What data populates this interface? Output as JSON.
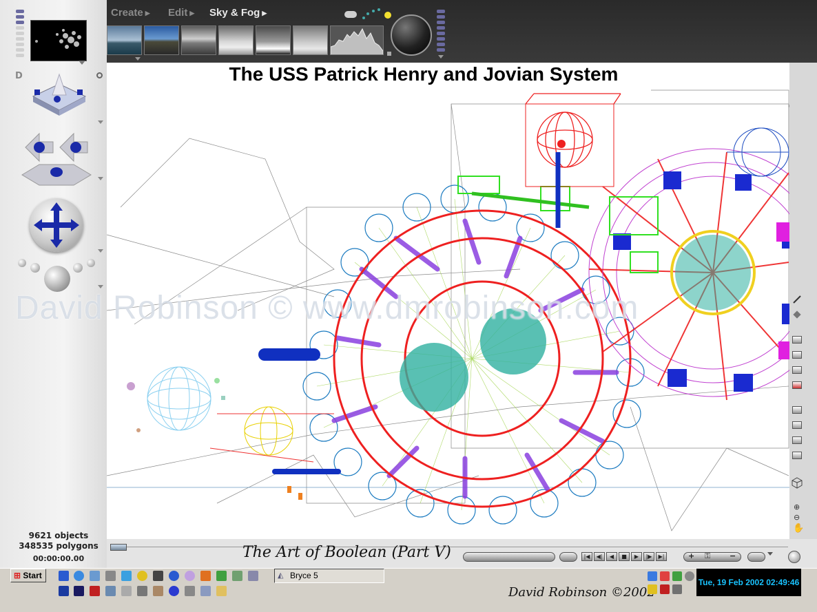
{
  "menus": [
    {
      "label": "Create",
      "active": false
    },
    {
      "label": "Edit",
      "active": false
    },
    {
      "label": "Sky & Fog",
      "active": true
    }
  ],
  "scene": {
    "title": "The USS Patrick Henry and Jovian System",
    "watermark": "David Robinson © www.dmrobinson.com"
  },
  "stats": {
    "objects": "9621 objects",
    "polygons": "348535 polygons",
    "time": "00:00:00.00"
  },
  "bottom": {
    "caption": "The Art of Boolean (Part V)",
    "signature": "David Robinson ©2002"
  },
  "taskbar": {
    "start_label": "Start",
    "window_button": "Bryce 5",
    "clock": "Tue, 19 Feb 2002 02:49:46"
  },
  "icons": {
    "quick_launch": [
      "app-a-icon",
      "internet-explorer-icon",
      "network-icon",
      "tool-icon",
      "photo-icon",
      "media-player-icon",
      "explorer-icon",
      "info-icon",
      "cd-icon",
      "flower-icon",
      "paint-icon",
      "image-icon",
      "plane-icon",
      "word-icon",
      "dots-icon",
      "acrobat-icon",
      "picture-icon",
      "2k-icon",
      "tools-icon",
      "scanner-icon",
      "info-blue-icon",
      "network-2-icon",
      "folder-icon"
    ],
    "tray": [
      "network-tray-icon",
      "user-tray-icon",
      "speaker-tray-icon",
      "shield-tray-icon",
      "z-tray-icon",
      "antivirus-tray-icon",
      "gear-tray-icon"
    ]
  },
  "colors": {
    "viewport_bg": "#ffffff",
    "clock_text": "#19c3ff",
    "toolbar_accent": "#6a6aa0"
  }
}
